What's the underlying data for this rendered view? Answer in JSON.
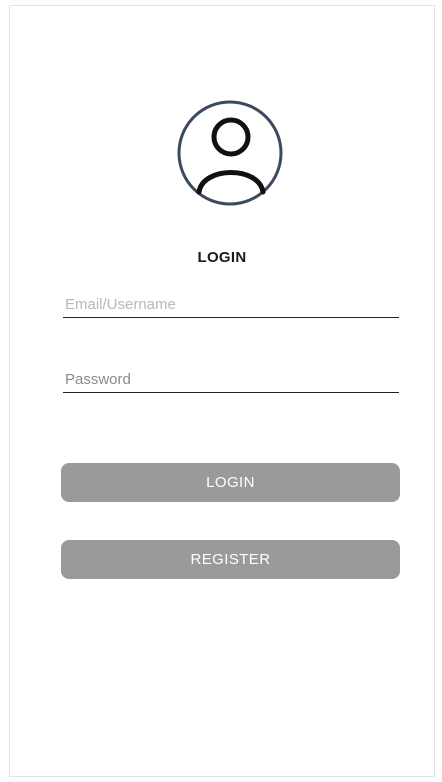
{
  "colors": {
    "avatar_ring": "#3b4a5e",
    "avatar_figure": "#111111",
    "button_bg": "#9a9a9a",
    "button_text": "#ffffff"
  },
  "header": {
    "icon": "user-avatar-icon",
    "title": "LOGIN"
  },
  "form": {
    "email": {
      "value": "",
      "placeholder": "Email/Username"
    },
    "password": {
      "value": "",
      "placeholder": "Password"
    }
  },
  "actions": {
    "login_label": "LOGIN",
    "register_label": "REGISTER"
  }
}
